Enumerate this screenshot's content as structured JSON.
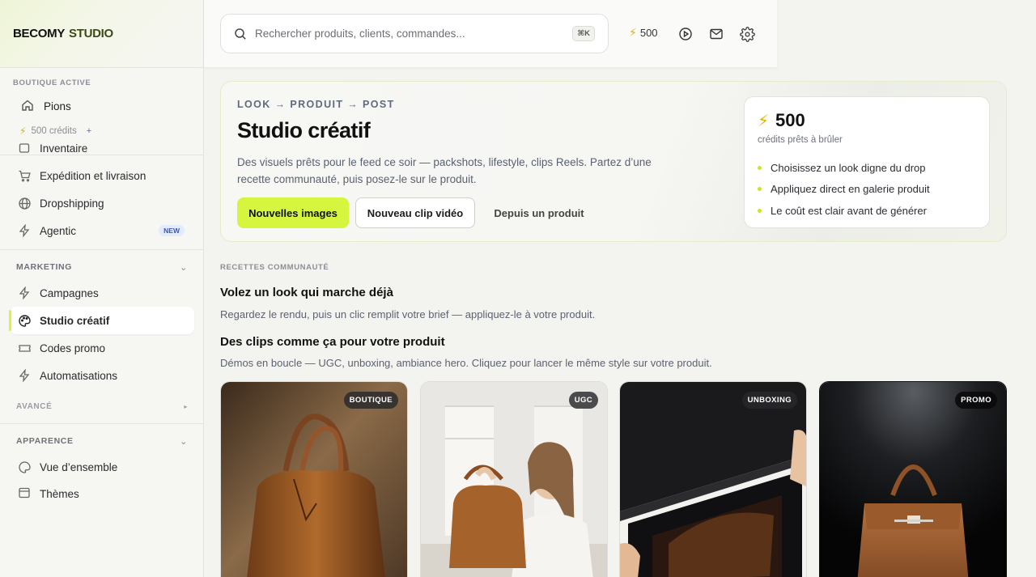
{
  "brand": {
    "part1": "BECOMY",
    "part2": "STUDIO"
  },
  "shop": {
    "caption": "BOUTIQUE ACTIVE",
    "name": "Pions",
    "credits": "500 crédits",
    "add_symbol": "+"
  },
  "sidebar": {
    "clipped_top_item": "Inventaire",
    "items_top": [
      {
        "label": "Expédition et livraison",
        "icon": "cart-icon"
      },
      {
        "label": "Dropshipping",
        "icon": "globe-icon"
      },
      {
        "label": "Agentic",
        "icon": "bolt-icon",
        "badge": "NEW"
      }
    ],
    "marketing": {
      "title": "MARKETING",
      "items": [
        {
          "label": "Campagnes",
          "icon": "bolt-icon"
        },
        {
          "label": "Studio créatif",
          "icon": "palette-icon",
          "active": true
        },
        {
          "label": "Codes promo",
          "icon": "ticket-icon"
        },
        {
          "label": "Automatisations",
          "icon": "bolt-icon"
        }
      ]
    },
    "advanced": {
      "title": "AVANCÉ"
    },
    "appearance": {
      "title": "APPARENCE",
      "items": [
        {
          "label": "Vue d’ensemble",
          "icon": "palette-icon"
        },
        {
          "label": "Thèmes",
          "icon": "layout-icon"
        }
      ]
    }
  },
  "topbar": {
    "search_placeholder": "Rechercher produits, clients, commandes...",
    "shortcut": "⌘K",
    "credits": "500",
    "icons": [
      "play-icon",
      "mail-icon",
      "settings-icon"
    ]
  },
  "hero": {
    "eyebrow": "LOOK → PRODUIT → POST",
    "title": "Studio créatif",
    "description": "Des visuels prêts pour le feed ce soir — packshots, lifestyle, clips Reels. Partez d’une recette communauté, puis posez-le sur le produit.",
    "buttons": {
      "primary": "Nouvelles images",
      "secondary": "Nouveau clip vidéo",
      "tertiary": "Depuis un produit"
    },
    "credit_card": {
      "amount": "500",
      "subtitle": "crédits prêts à brûler",
      "bullets": [
        "Choisissez un look digne du drop",
        "Appliquez direct en galerie produit",
        "Le coût est clair avant de générer"
      ]
    }
  },
  "recipes": {
    "caption": "RECETTES COMMUNAUTÉ",
    "section1_title": "Volez un look qui marche déjà",
    "section1_desc": "Regardez le rendu, puis un clic remplit votre brief — appliquez-le à votre produit.",
    "section2_title": "Des clips comme ça pour votre produit",
    "section2_desc": "Démos en boucle — UGC, unboxing, ambiance hero. Cliquez pour lancer le même style sur votre produit.",
    "cards": [
      {
        "tag": "BOUTIQUE"
      },
      {
        "tag": "UGC"
      },
      {
        "tag": "UNBOXING"
      },
      {
        "tag": "PROMO"
      }
    ]
  },
  "colors": {
    "accent": "#d6f53f",
    "brand_dark_green": "#3b4a14",
    "credit_bolt": "#e0b100"
  }
}
